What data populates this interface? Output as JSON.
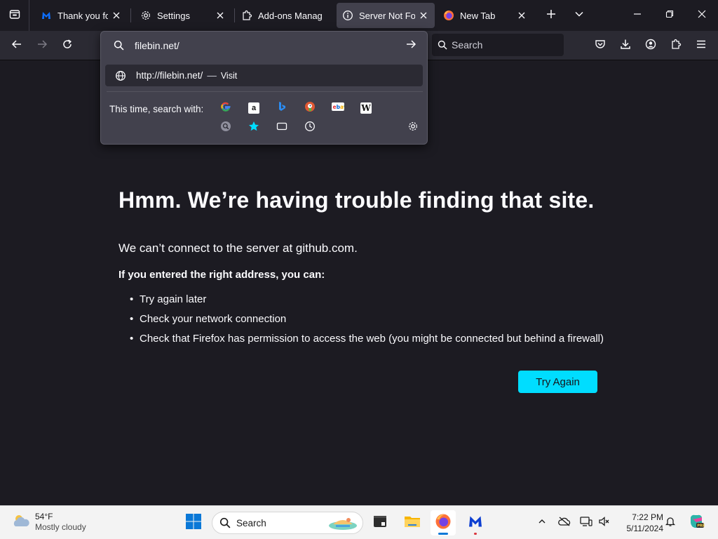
{
  "tabs": [
    {
      "title": "Thank you for d",
      "icon": "malwarebytes-icon",
      "active": false
    },
    {
      "title": "Settings",
      "icon": "gear-icon",
      "active": false
    },
    {
      "title": "Add-ons Manag",
      "icon": "puzzle-icon",
      "active": false
    },
    {
      "title": "Server Not Foun",
      "icon": "info-icon",
      "active": true
    },
    {
      "title": "New Tab",
      "icon": "firefox-icon",
      "active": false
    }
  ],
  "urlbar": {
    "value": "filebin.net/",
    "result_url": "http://filebin.net/",
    "result_separator": "—",
    "result_action": "Visit",
    "oneoff_label": "This time, search with:",
    "engines": [
      "google-icon",
      "amazon-icon",
      "bing-icon",
      "duckduckgo-icon",
      "ebay-icon",
      "wikipedia-icon",
      "search-engine-icon",
      "bookmarks-star-icon",
      "tabs-icon",
      "history-icon"
    ]
  },
  "searchbar": {
    "placeholder": "Search"
  },
  "page": {
    "title": "Hmm. We’re having trouble finding that site.",
    "description": "We can’t connect to the server at github.com.",
    "subhead": "If you entered the right address, you can:",
    "suggestions": [
      "Try again later",
      "Check your network connection",
      "Check that Firefox has permission to access the web (you might be connected but behind a firewall)"
    ],
    "try_again": "Try Again"
  },
  "taskbar": {
    "weather_temp": "54°F",
    "weather_desc": "Mostly cloudy",
    "search_placeholder": "Search",
    "time": "7:22 PM",
    "date": "5/11/2024"
  },
  "colors": {
    "page_bg": "#1c1b22",
    "toolbar_bg": "#2b2a33",
    "panel_bg": "#42414d",
    "accent": "#00ddff",
    "taskbar_bg": "#f3f3f3"
  }
}
